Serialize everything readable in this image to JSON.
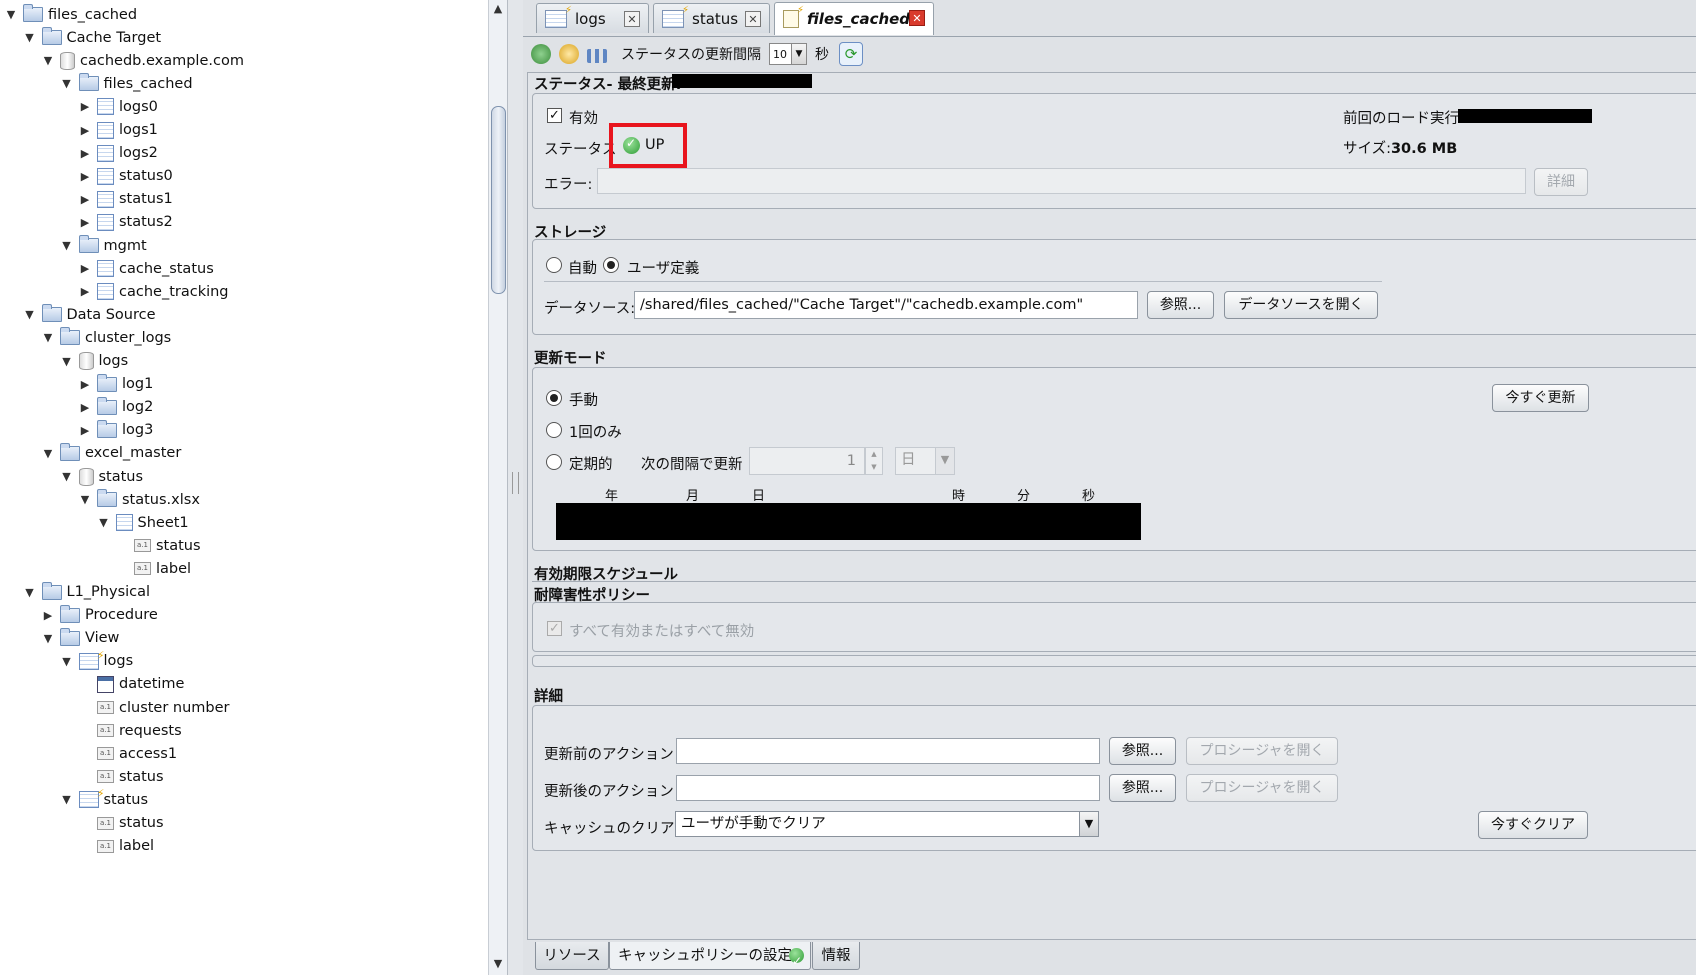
{
  "tree": [
    {
      "label": "files_cached",
      "indent": 0,
      "icon": "folder",
      "expand": "open"
    },
    {
      "label": "Cache Target",
      "indent": 1,
      "icon": "folder",
      "expand": "open"
    },
    {
      "label": "cachedb.example.com",
      "indent": 2,
      "icon": "db",
      "expand": "open"
    },
    {
      "label": "files_cached",
      "indent": 3,
      "icon": "folder",
      "expand": "open"
    },
    {
      "label": "logs0",
      "indent": 4,
      "icon": "table",
      "expand": "closed"
    },
    {
      "label": "logs1",
      "indent": 4,
      "icon": "table",
      "expand": "closed"
    },
    {
      "label": "logs2",
      "indent": 4,
      "icon": "table",
      "expand": "closed"
    },
    {
      "label": "status0",
      "indent": 4,
      "icon": "table",
      "expand": "closed"
    },
    {
      "label": "status1",
      "indent": 4,
      "icon": "table",
      "expand": "closed"
    },
    {
      "label": "status2",
      "indent": 4,
      "icon": "table",
      "expand": "closed"
    },
    {
      "label": "mgmt",
      "indent": 3,
      "icon": "folder",
      "expand": "open"
    },
    {
      "label": "cache_status",
      "indent": 4,
      "icon": "table",
      "expand": "closed"
    },
    {
      "label": "cache_tracking",
      "indent": 4,
      "icon": "table",
      "expand": "closed"
    },
    {
      "label": "Data Source",
      "indent": 1,
      "icon": "folder",
      "expand": "open"
    },
    {
      "label": "cluster_logs",
      "indent": 2,
      "icon": "folder",
      "expand": "open"
    },
    {
      "label": "logs",
      "indent": 3,
      "icon": "db",
      "expand": "open"
    },
    {
      "label": "log1",
      "indent": 4,
      "icon": "folder",
      "expand": "closed"
    },
    {
      "label": "log2",
      "indent": 4,
      "icon": "folder",
      "expand": "closed"
    },
    {
      "label": "log3",
      "indent": 4,
      "icon": "folder",
      "expand": "closed"
    },
    {
      "label": "excel_master",
      "indent": 2,
      "icon": "folder",
      "expand": "open"
    },
    {
      "label": "status",
      "indent": 3,
      "icon": "db",
      "expand": "open"
    },
    {
      "label": "status.xlsx",
      "indent": 4,
      "icon": "folder",
      "expand": "open"
    },
    {
      "label": "Sheet1",
      "indent": 5,
      "icon": "table",
      "expand": "open"
    },
    {
      "label": "status",
      "indent": 6,
      "icon": "col",
      "expand": "none"
    },
    {
      "label": "label",
      "indent": 6,
      "icon": "col",
      "expand": "none"
    },
    {
      "label": "L1_Physical",
      "indent": 1,
      "icon": "folder",
      "expand": "open"
    },
    {
      "label": "Procedure",
      "indent": 2,
      "icon": "folder",
      "expand": "closed"
    },
    {
      "label": "View",
      "indent": 2,
      "icon": "folder",
      "expand": "open"
    },
    {
      "label": "logs",
      "indent": 3,
      "icon": "view",
      "expand": "open"
    },
    {
      "label": "datetime",
      "indent": 4,
      "icon": "cal",
      "expand": "none"
    },
    {
      "label": "cluster number",
      "indent": 4,
      "icon": "col",
      "expand": "none"
    },
    {
      "label": "requests",
      "indent": 4,
      "icon": "col",
      "expand": "none"
    },
    {
      "label": "access1",
      "indent": 4,
      "icon": "col",
      "expand": "none"
    },
    {
      "label": "status",
      "indent": 4,
      "icon": "col",
      "expand": "none"
    },
    {
      "label": "status",
      "indent": 3,
      "icon": "view",
      "expand": "open"
    },
    {
      "label": "status",
      "indent": 4,
      "icon": "col",
      "expand": "none"
    },
    {
      "label": "label",
      "indent": 4,
      "icon": "col",
      "expand": "none"
    }
  ],
  "tabs": {
    "logs": "logs",
    "status": "status",
    "files_cached": "files_cached",
    "close": "✕"
  },
  "toolbar": {
    "interval_label": "ステータスの更新間隔",
    "interval_value": "10",
    "seconds": "秒"
  },
  "status_section": {
    "title": "ステータス- 最終更新:",
    "enabled": "有効",
    "status_label": "ステータス",
    "status_value": "UP",
    "last_load": "前回のロード実行:",
    "size_label": "サイズ:",
    "size_value": "30.6 MB",
    "error_label": "エラー:",
    "detail_button": "詳細"
  },
  "storage": {
    "title": "ストレージ",
    "auto": "自動",
    "user_defined": "ユーザ定義",
    "datasource_label": "データソース:",
    "datasource_value": "/shared/files_cached/\"Cache Target\"/\"cachedb.example.com\"",
    "browse": "参照...",
    "open_datasource": "データソースを開く"
  },
  "refresh_mode": {
    "title": "更新モード",
    "manual": "手動",
    "once": "1回のみ",
    "periodic": "定期的",
    "interval_label": "次の間隔で更新",
    "interval_value": "1",
    "unit": "日",
    "refresh_now": "今すぐ更新",
    "date_year": "年",
    "date_month": "月",
    "date_day": "日",
    "time_hour": "時",
    "time_min": "分",
    "time_sec": "秒"
  },
  "expiry": {
    "title": "有効期限スケジュール"
  },
  "fault": {
    "title": "耐障害性ポリシー",
    "all_toggle": "すべて有効またはすべて無効"
  },
  "details": {
    "title": "詳細",
    "pre_action": "更新前のアクション",
    "post_action": "更新後のアクション",
    "browse": "参照...",
    "open_procedure": "プロシージャを開く",
    "clear_label": "キャッシュのクリア",
    "clear_value": "ユーザが手動でクリア",
    "clear_now": "今すぐクリア"
  },
  "bottom_tabs": {
    "resource": "リソース",
    "cache_policy": "キャッシュポリシーの設定",
    "info": "情報"
  },
  "colors": {
    "highlight": "#e8141d",
    "status_up": "#2e9c35"
  }
}
